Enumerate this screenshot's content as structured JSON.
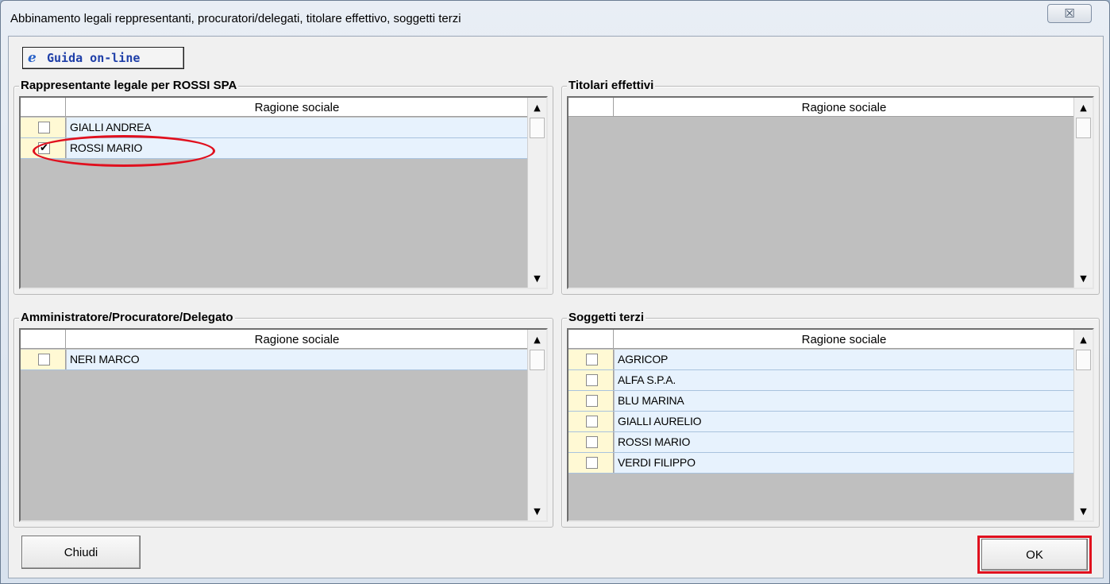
{
  "window": {
    "title": "Abbinamento legali reppresentanti, procuratori/delegati, titolare effettivo, soggetti terzi",
    "close_glyph": "☒"
  },
  "toolbar": {
    "guide_icon": "e",
    "guide_label": "Guida on-line"
  },
  "panels": {
    "legal_rep": {
      "title": "Rappresentante legale per ROSSI SPA",
      "column": "Ragione sociale",
      "rows": [
        {
          "name": "GIALLI ANDREA",
          "checked": false,
          "mark": ""
        },
        {
          "name": "ROSSI MARIO",
          "checked": true,
          "mark": "✔"
        }
      ]
    },
    "beneficial_owners": {
      "title": "Titolari effettivi",
      "column": "Ragione sociale",
      "rows": []
    },
    "administrator": {
      "title": "Amministratore/Procuratore/Delegato",
      "column": "Ragione sociale",
      "rows": [
        {
          "name": "NERI MARCO",
          "checked": false,
          "mark": ""
        }
      ]
    },
    "third_parties": {
      "title": "Soggetti terzi",
      "column": "Ragione sociale",
      "rows": [
        {
          "name": "AGRICOP",
          "checked": false,
          "mark": ""
        },
        {
          "name": "ALFA S.P.A.",
          "checked": false,
          "mark": ""
        },
        {
          "name": "BLU MARINA",
          "checked": false,
          "mark": ""
        },
        {
          "name": "GIALLI AURELIO",
          "checked": false,
          "mark": ""
        },
        {
          "name": "ROSSI MARIO",
          "checked": false,
          "mark": ""
        },
        {
          "name": "VERDI FILIPPO",
          "checked": false,
          "mark": ""
        }
      ]
    }
  },
  "scroll": {
    "up": "▲",
    "down": "▼"
  },
  "buttons": {
    "close_label": "Chiudi",
    "ok_label": "OK"
  },
  "colors": {
    "annotation": "#e0101e",
    "row_bg": "#e7f2fd",
    "check_cell_bg": "#fff9d4",
    "grid_empty": "#bfbfbf"
  }
}
